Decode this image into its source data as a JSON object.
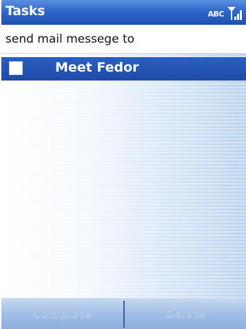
{
  "title_bar": {
    "title": "Tasks",
    "network_mode": "ABC",
    "signal_icon": "signal-strength-icon"
  },
  "new_task": {
    "value": "send mail messege to",
    "placeholder": ""
  },
  "tasks": [
    {
      "label": "Meet Fedor",
      "completed": false,
      "selected": true
    }
  ],
  "softkeys": {
    "left": "Complete",
    "right": "Delete"
  },
  "colors": {
    "title_bar": "#2f67c8",
    "selection": "#1e4aa7",
    "softkey_bar": "#9ebde6"
  }
}
